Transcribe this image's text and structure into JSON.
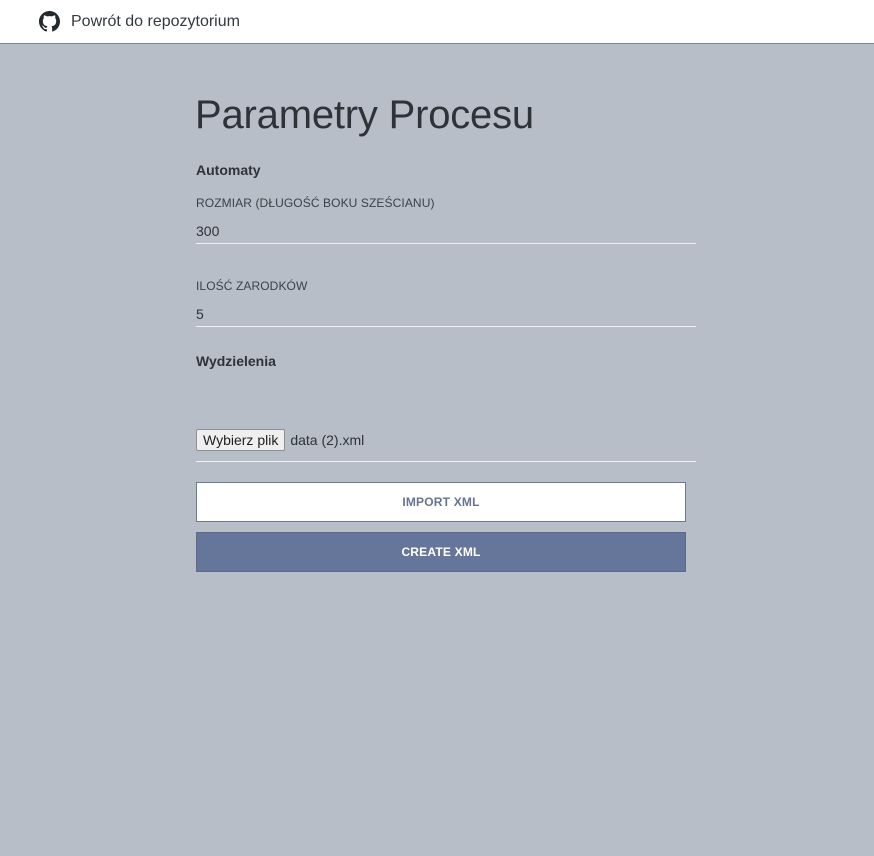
{
  "header": {
    "repo_link_label": "Powrót do repozytorium",
    "repo_icon": "github-icon"
  },
  "main": {
    "title": "Parametry Procesu",
    "automaty": {
      "heading": "Automaty",
      "size_label": "ROZMIAR (DŁUGOŚĆ BOKU SZEŚCIANU)",
      "size_value": "300",
      "seeds_label": "ILOŚĆ ZARODKÓW",
      "seeds_value": "5"
    },
    "wydzielenia": {
      "heading": "Wydzielenia",
      "file_button_label": "Wybierz plik",
      "file_name": "data (2).xml"
    },
    "buttons": {
      "import_label": "IMPORT XML",
      "create_label": "CREATE XML"
    }
  },
  "colors": {
    "background": "#b7bec7",
    "header_bg": "#ffffff",
    "primary_button": "#66759a",
    "secondary_button_text": "#67748f"
  }
}
